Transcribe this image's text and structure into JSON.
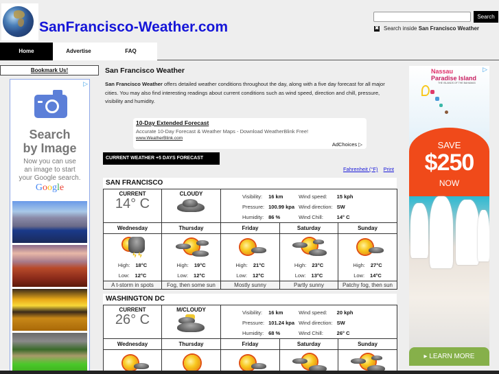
{
  "header": {
    "site_title": "SanFrancisco-Weather.com",
    "logo_icon": "globe-icon",
    "search": {
      "input_value": "",
      "placeholder": "",
      "button_label": "Search",
      "checkbox_checked": true,
      "scope_prefix": "Search inside",
      "scope_site": "San Francisco Weather"
    }
  },
  "nav": {
    "items": [
      {
        "label": "Home",
        "active": true
      },
      {
        "label": "Advertise",
        "active": false
      },
      {
        "label": "FAQ",
        "active": false
      }
    ]
  },
  "sidebar": {
    "bookmark_label": "Bookmark Us!",
    "ad": {
      "icon": "camera-icon",
      "headline_1": "Search",
      "headline_2": "by Image",
      "body_1": "Now you can use",
      "body_2": "an image to start",
      "body_3": "your Google search.",
      "brand": "Google",
      "adchoices_icon": "adchoices-icon"
    }
  },
  "main": {
    "title": "San Francisco Weather",
    "intro_bold": "San Francisco Weather",
    "intro_text": " offers detailed weather conditions throughout the day, along with a five day forecast for all major cities. You may also find interesting readings about current conditions such as wind speed, direction and chill, pressure, visibility and humidity.",
    "text_ad": {
      "title": "10-Day Extended Forecast",
      "description": "Accurate 10-Day Forecast & Weather Maps - Download WeatherBlink Free!",
      "url": "www.WeatherBlink.com",
      "adchoices": "AdChoices"
    },
    "forecast_tab": "CURRENT WEATHER +5 DAYS FORECAST",
    "links": {
      "fahrenheit": "Fahrenheit (°F)",
      "print": "Print"
    },
    "labels": {
      "current": "CURRENT",
      "visibility": "Visibility:",
      "pressure": "Pressure:",
      "humidity": "Humidity:",
      "wind_speed": "Wind speed:",
      "wind_direction": "Wind direction:",
      "wind_chill": "Wind Chill:",
      "high": "High:",
      "low": "Low:"
    },
    "cities": [
      {
        "name": "SAN FRANCISCO",
        "current_temp": "14° C",
        "condition": "CLOUDY",
        "condition_icon": "cloudy-icon",
        "visibility": "16 km",
        "pressure": "100.99 kpa",
        "humidity": "86 %",
        "wind_speed": "15 kph",
        "wind_direction": "SW",
        "wind_chill": "14° C",
        "forecast": [
          {
            "day": "Wednesday",
            "icon": "thunderstorm-icon",
            "high": "18°C",
            "low": "12°C",
            "desc": "A t-storm in spots"
          },
          {
            "day": "Thursday",
            "icon": "fog-then-sun-icon",
            "high": "19°C",
            "low": "12°C",
            "desc": "Fog, then some sun"
          },
          {
            "day": "Friday",
            "icon": "mostly-sunny-icon",
            "high": "21°C",
            "low": "12°C",
            "desc": "Mostly sunny"
          },
          {
            "day": "Saturday",
            "icon": "partly-sunny-icon",
            "high": "23°C",
            "low": "13°C",
            "desc": "Partly sunny"
          },
          {
            "day": "Sunday",
            "icon": "mostly-sunny-icon",
            "high": "27°C",
            "low": "14°C",
            "desc": "Patchy fog, then sun"
          }
        ]
      },
      {
        "name": "WASHINGTON DC",
        "current_temp": "26° C",
        "condition": "M/CLOUDY",
        "condition_icon": "mostly-cloudy-icon",
        "visibility": "16 km",
        "pressure": "101.24 kpa",
        "humidity": "68 %",
        "wind_speed": "20 kph",
        "wind_direction": "SW",
        "wind_chill": "26° C",
        "forecast": [
          {
            "day": "Wednesday",
            "icon": "mostly-sunny-icon"
          },
          {
            "day": "Thursday",
            "icon": "sunny-icon"
          },
          {
            "day": "Friday",
            "icon": "mostly-sunny-icon"
          },
          {
            "day": "Saturday",
            "icon": "partly-sunny-icon"
          },
          {
            "day": "Sunday",
            "icon": "partly-sunny-icon"
          }
        ]
      }
    ]
  },
  "right_ad": {
    "brand_1": "Nassau",
    "brand_2": "Paradise Island",
    "tagline": "THE ISLANDS OF THE BAHAMAS",
    "save": "SAVE",
    "amount": "$250",
    "now": "NOW",
    "cta": "▸ LEARN MORE",
    "adchoices_icon": "adchoices-icon"
  }
}
